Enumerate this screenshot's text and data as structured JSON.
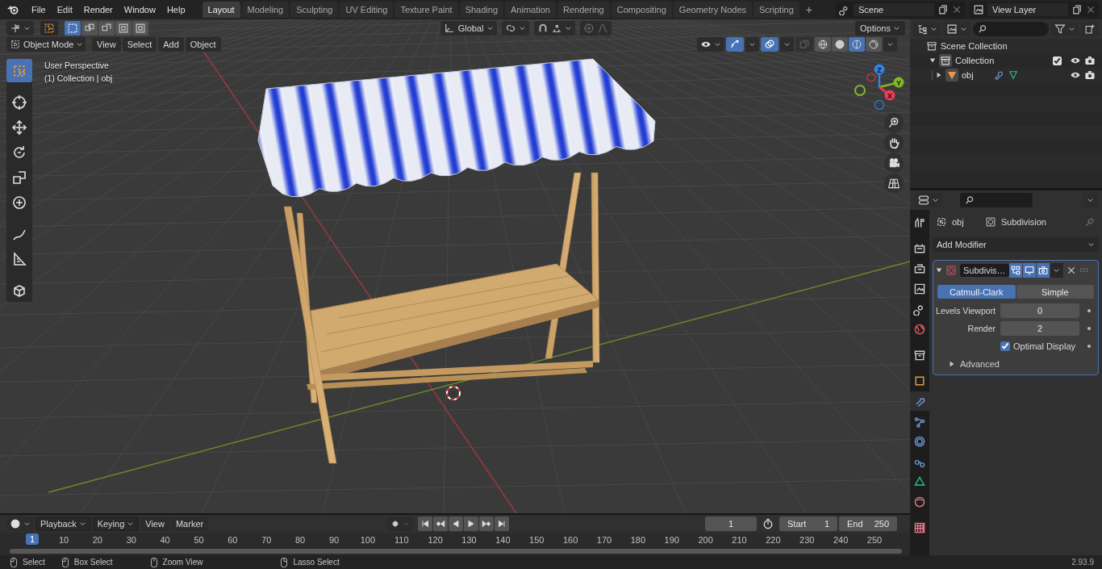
{
  "menu": [
    "File",
    "Edit",
    "Render",
    "Window",
    "Help"
  ],
  "workspaces": [
    {
      "label": "Layout",
      "selected": true
    },
    {
      "label": "Modeling",
      "selected": false
    },
    {
      "label": "Sculpting",
      "selected": false
    },
    {
      "label": "UV Editing",
      "selected": false
    },
    {
      "label": "Texture Paint",
      "selected": false
    },
    {
      "label": "Shading",
      "selected": false
    },
    {
      "label": "Animation",
      "selected": false
    },
    {
      "label": "Rendering",
      "selected": false
    },
    {
      "label": "Compositing",
      "selected": false
    },
    {
      "label": "Geometry Nodes",
      "selected": false
    },
    {
      "label": "Scripting",
      "selected": false
    }
  ],
  "add_workspace": "+",
  "scene": "Scene",
  "view_layer": "View Layer",
  "viewport": {
    "select_modes": [
      {
        "selected": true
      },
      {
        "selected": false
      },
      {
        "selected": false
      },
      {
        "selected": false
      },
      {
        "selected": false
      }
    ],
    "transform_orientation": "Global",
    "options": "Options",
    "mode": "Object Mode",
    "menus": [
      "View",
      "Select",
      "Add",
      "Object"
    ],
    "gizmos_on": true,
    "overlays_on": true,
    "shading": [
      {
        "selected": false
      },
      {
        "selected": false
      },
      {
        "selected": true
      },
      {
        "selected": false
      }
    ],
    "info": [
      "User Perspective",
      "(1) Collection | obj"
    ],
    "axes": [
      {
        "label": "Z",
        "color": "#2f83e6"
      },
      {
        "label": "Y",
        "color": "#83b726"
      },
      {
        "label": "X",
        "color": "#f23a52"
      }
    ],
    "tools": [
      {
        "selected": true
      },
      {
        "selected": false
      },
      {
        "selected": false
      },
      {
        "selected": false
      },
      {
        "selected": false
      },
      {
        "selected": false
      },
      {
        "selected": false
      },
      {
        "selected": false
      },
      {
        "selected": false
      }
    ]
  },
  "outliner": {
    "tree": {
      "label": "Scene Collection",
      "children": [
        {
          "label": "Collection",
          "expanded": true,
          "checked": true,
          "children": [
            {
              "label": "obj",
              "expanded": false
            }
          ]
        }
      ]
    }
  },
  "properties": {
    "tabs": [
      {
        "selected": false
      },
      {
        "selected": false
      },
      {
        "selected": false
      },
      {
        "selected": false
      },
      {
        "selected": false
      },
      {
        "selected": false
      },
      {
        "selected": false
      },
      {
        "selected": false
      },
      {
        "selected": true
      },
      {
        "selected": false
      },
      {
        "selected": false
      },
      {
        "selected": false
      },
      {
        "selected": false
      },
      {
        "selected": false
      },
      {
        "selected": false
      }
    ],
    "object": "obj",
    "modifier_name": "Subdivision",
    "add_modifier": "Add Modifier",
    "modifier": {
      "expanded": true,
      "name": "Subdivis…",
      "toggles": [
        {
          "on": true
        },
        {
          "on": true
        },
        {
          "on": true
        }
      ],
      "types": [
        {
          "label": "Catmull-Clark",
          "selected": true
        },
        {
          "label": "Simple",
          "selected": false
        }
      ],
      "fields": [
        {
          "label": "Levels Viewport",
          "value": "0"
        },
        {
          "label": "Render",
          "value": "2"
        }
      ],
      "optimal_display": {
        "label": "Optimal Display",
        "checked": true
      },
      "advanced": {
        "label": "Advanced",
        "expanded": false
      }
    }
  },
  "timeline": {
    "menus": [
      "Playback",
      "Keying",
      "View",
      "Marker"
    ],
    "current_frame": "1",
    "start": {
      "label": "Start",
      "value": "1"
    },
    "end": {
      "label": "End",
      "value": "250"
    },
    "playhead": "1",
    "ticks": [
      "10",
      "20",
      "30",
      "40",
      "50",
      "60",
      "70",
      "80",
      "90",
      "100",
      "110",
      "120",
      "130",
      "140",
      "150",
      "160",
      "170",
      "180",
      "190",
      "200",
      "210",
      "220",
      "230",
      "240",
      "250"
    ]
  },
  "status": {
    "hints": [
      "Select",
      "Box Select",
      "Zoom View",
      "Lasso Select"
    ],
    "version": "2.93.9"
  }
}
